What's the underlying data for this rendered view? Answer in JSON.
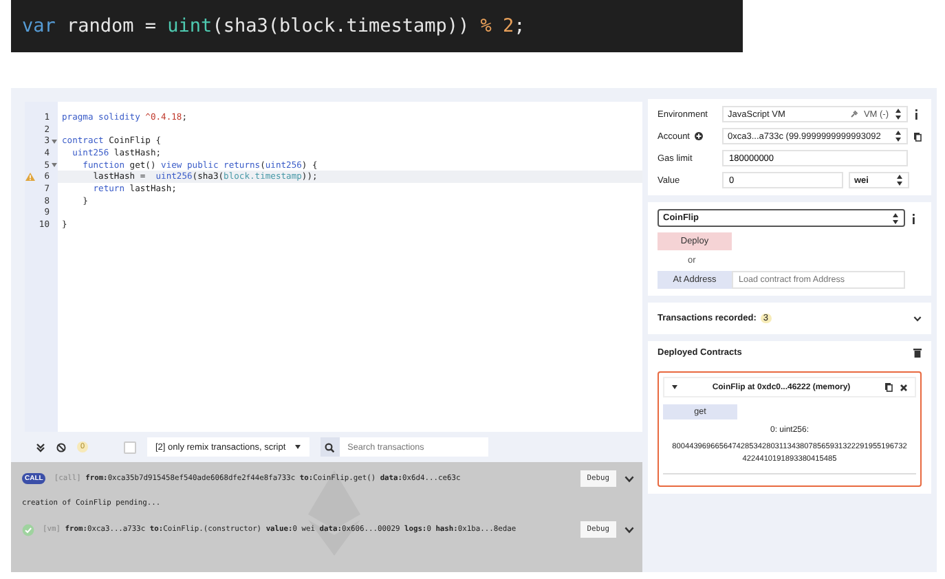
{
  "banner": {
    "tokens": [
      {
        "text": "var",
        "kind": "kw"
      },
      {
        "text": " random = ",
        "kind": "plain"
      },
      {
        "text": "uint",
        "kind": "type"
      },
      {
        "text": "(sha3(block.timestamp)) ",
        "kind": "plain"
      },
      {
        "text": "% 2",
        "kind": "num"
      },
      {
        "text": ";",
        "kind": "plain"
      }
    ]
  },
  "editor": {
    "lines": [
      {
        "number": "1",
        "fold": false,
        "warning": false,
        "highlighted": false,
        "tokens": [
          {
            "text": "pragma solidity ",
            "kind": "kw"
          },
          {
            "text": "^0.4.18",
            "kind": "num"
          },
          {
            "text": ";",
            "kind": "plain"
          }
        ]
      },
      {
        "number": "2",
        "fold": false,
        "warning": false,
        "highlighted": false
      },
      {
        "number": "3",
        "fold": true,
        "warning": false,
        "highlighted": false,
        "tokens": [
          {
            "text": "contract ",
            "kind": "kw"
          },
          {
            "text": "CoinFlip {",
            "kind": "plain"
          }
        ]
      },
      {
        "number": "4",
        "fold": false,
        "warning": false,
        "highlighted": false,
        "tokens": [
          {
            "text": "  uint256 ",
            "kind": "kw"
          },
          {
            "text": "lastHash;",
            "kind": "plain"
          }
        ]
      },
      {
        "number": "5",
        "fold": true,
        "warning": false,
        "highlighted": false,
        "tokens": [
          {
            "text": "    function ",
            "kind": "kw"
          },
          {
            "text": "get() ",
            "kind": "plain"
          },
          {
            "text": "view public returns",
            "kind": "kw"
          },
          {
            "text": "(",
            "kind": "plain"
          },
          {
            "text": "uint256",
            "kind": "kw"
          },
          {
            "text": ") {",
            "kind": "plain"
          }
        ]
      },
      {
        "number": "6",
        "fold": false,
        "warning": true,
        "highlighted": true,
        "tokens": [
          {
            "text": "      lastHash =  ",
            "kind": "plain"
          },
          {
            "text": "uint256",
            "kind": "kw"
          },
          {
            "text": "(sha3(",
            "kind": "plain"
          },
          {
            "text": "block.timestamp",
            "kind": "type"
          },
          {
            "text": "));",
            "kind": "plain"
          }
        ]
      },
      {
        "number": "7",
        "fold": false,
        "warning": false,
        "highlighted": false,
        "tokens": [
          {
            "text": "      return ",
            "kind": "kw"
          },
          {
            "text": "lastHash;",
            "kind": "plain"
          }
        ]
      },
      {
        "number": "8",
        "fold": false,
        "warning": false,
        "highlighted": false,
        "tokens": [
          {
            "text": "    }",
            "kind": "plain"
          }
        ]
      },
      {
        "number": "9",
        "fold": false,
        "warning": false,
        "highlighted": false
      },
      {
        "number": "10",
        "fold": false,
        "warning": false,
        "highlighted": false,
        "tokens": [
          {
            "text": "}",
            "kind": "plain"
          }
        ]
      }
    ]
  },
  "terminal": {
    "count": "0",
    "filter_checked": false,
    "filter": "[2] only remix transactions, script",
    "search_placeholder": "Search transactions",
    "logs": [
      {
        "kind": "call",
        "badge": "CALL",
        "tag": "[call]",
        "text": "**from:**0xca35b7d915458ef540ade6068dfe2f44e8fa733c **to:**CoinFlip.get() **data:**0x6d4...ce63c",
        "button": "Debug"
      },
      {
        "kind": "info",
        "text": "creation of CoinFlip pending..."
      },
      {
        "kind": "vm",
        "tag": "[vm]",
        "text": "**from:**0xca3...a733c **to:**CoinFlip.(constructor) **value:**0 wei **data:**0x606...00029 **logs:**0 **hash:**0x1ba...8edae",
        "button": "Debug"
      }
    ]
  },
  "run_panel": {
    "environment": {
      "label": "Environment",
      "value": "JavaScript VM",
      "network": "VM (-)"
    },
    "account": {
      "label": "Account",
      "value": "0xca3...a733c (99.9999999999993092"
    },
    "gas_limit": {
      "label": "Gas limit",
      "value": "180000000"
    },
    "value": {
      "label": "Value",
      "value": "0",
      "unit": "wei"
    },
    "contract": "CoinFlip",
    "deploy": "Deploy",
    "or": "or",
    "at_address": "At Address",
    "address_placeholder": "Load contract from Address",
    "transactions": {
      "label": "Transactions recorded:",
      "count": "3"
    },
    "deployed": {
      "title": "Deployed Contracts",
      "instance": {
        "title": "CoinFlip at 0xdc0...46222 (memory)",
        "expanded": true,
        "method": "get",
        "output_label": "0: uint256:",
        "output_value": "80044396966564742853428031134380785659313222919551967324224410191893380415485"
      }
    }
  }
}
